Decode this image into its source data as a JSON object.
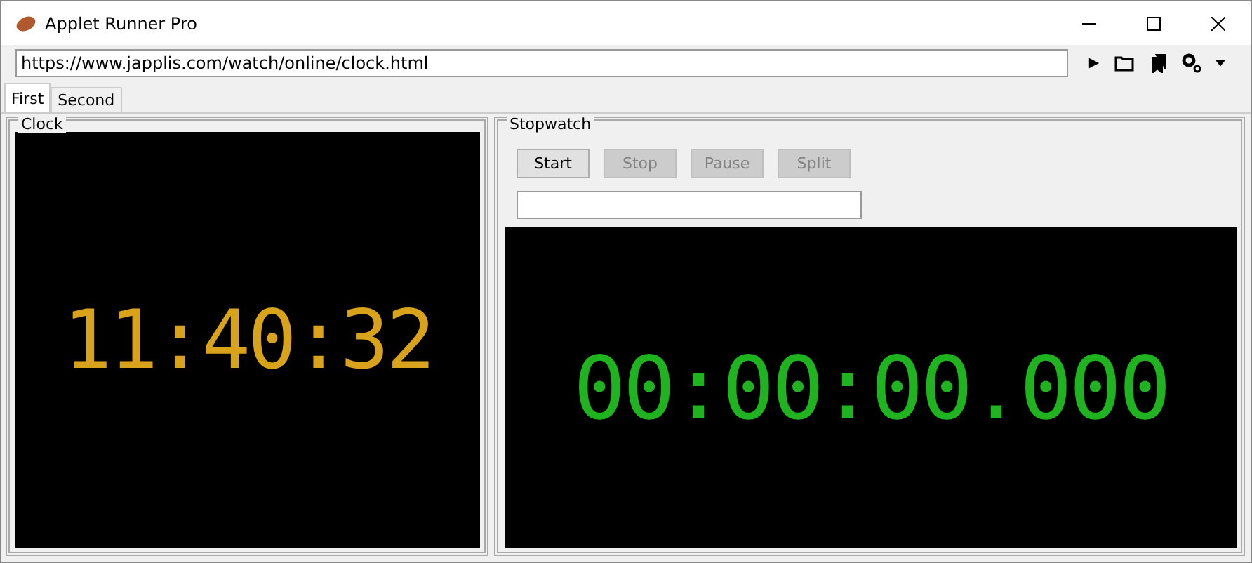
{
  "window": {
    "title": "Applet Runner Pro"
  },
  "address": {
    "value": "https://www.japplis.com/watch/online/clock.html"
  },
  "tabs": [
    {
      "label": "First",
      "selected": true
    },
    {
      "label": "Second",
      "selected": false
    }
  ],
  "clock": {
    "title": "Clock",
    "time": "11:40:32",
    "color": "#d9a21b"
  },
  "stopwatch": {
    "title": "Stopwatch",
    "buttons": [
      {
        "label": "Start",
        "disabled": false
      },
      {
        "label": "Stop",
        "disabled": true
      },
      {
        "label": "Pause",
        "disabled": true
      },
      {
        "label": "Split",
        "disabled": true
      }
    ],
    "time": "00:00:00.000",
    "color": "#1fb41f"
  }
}
